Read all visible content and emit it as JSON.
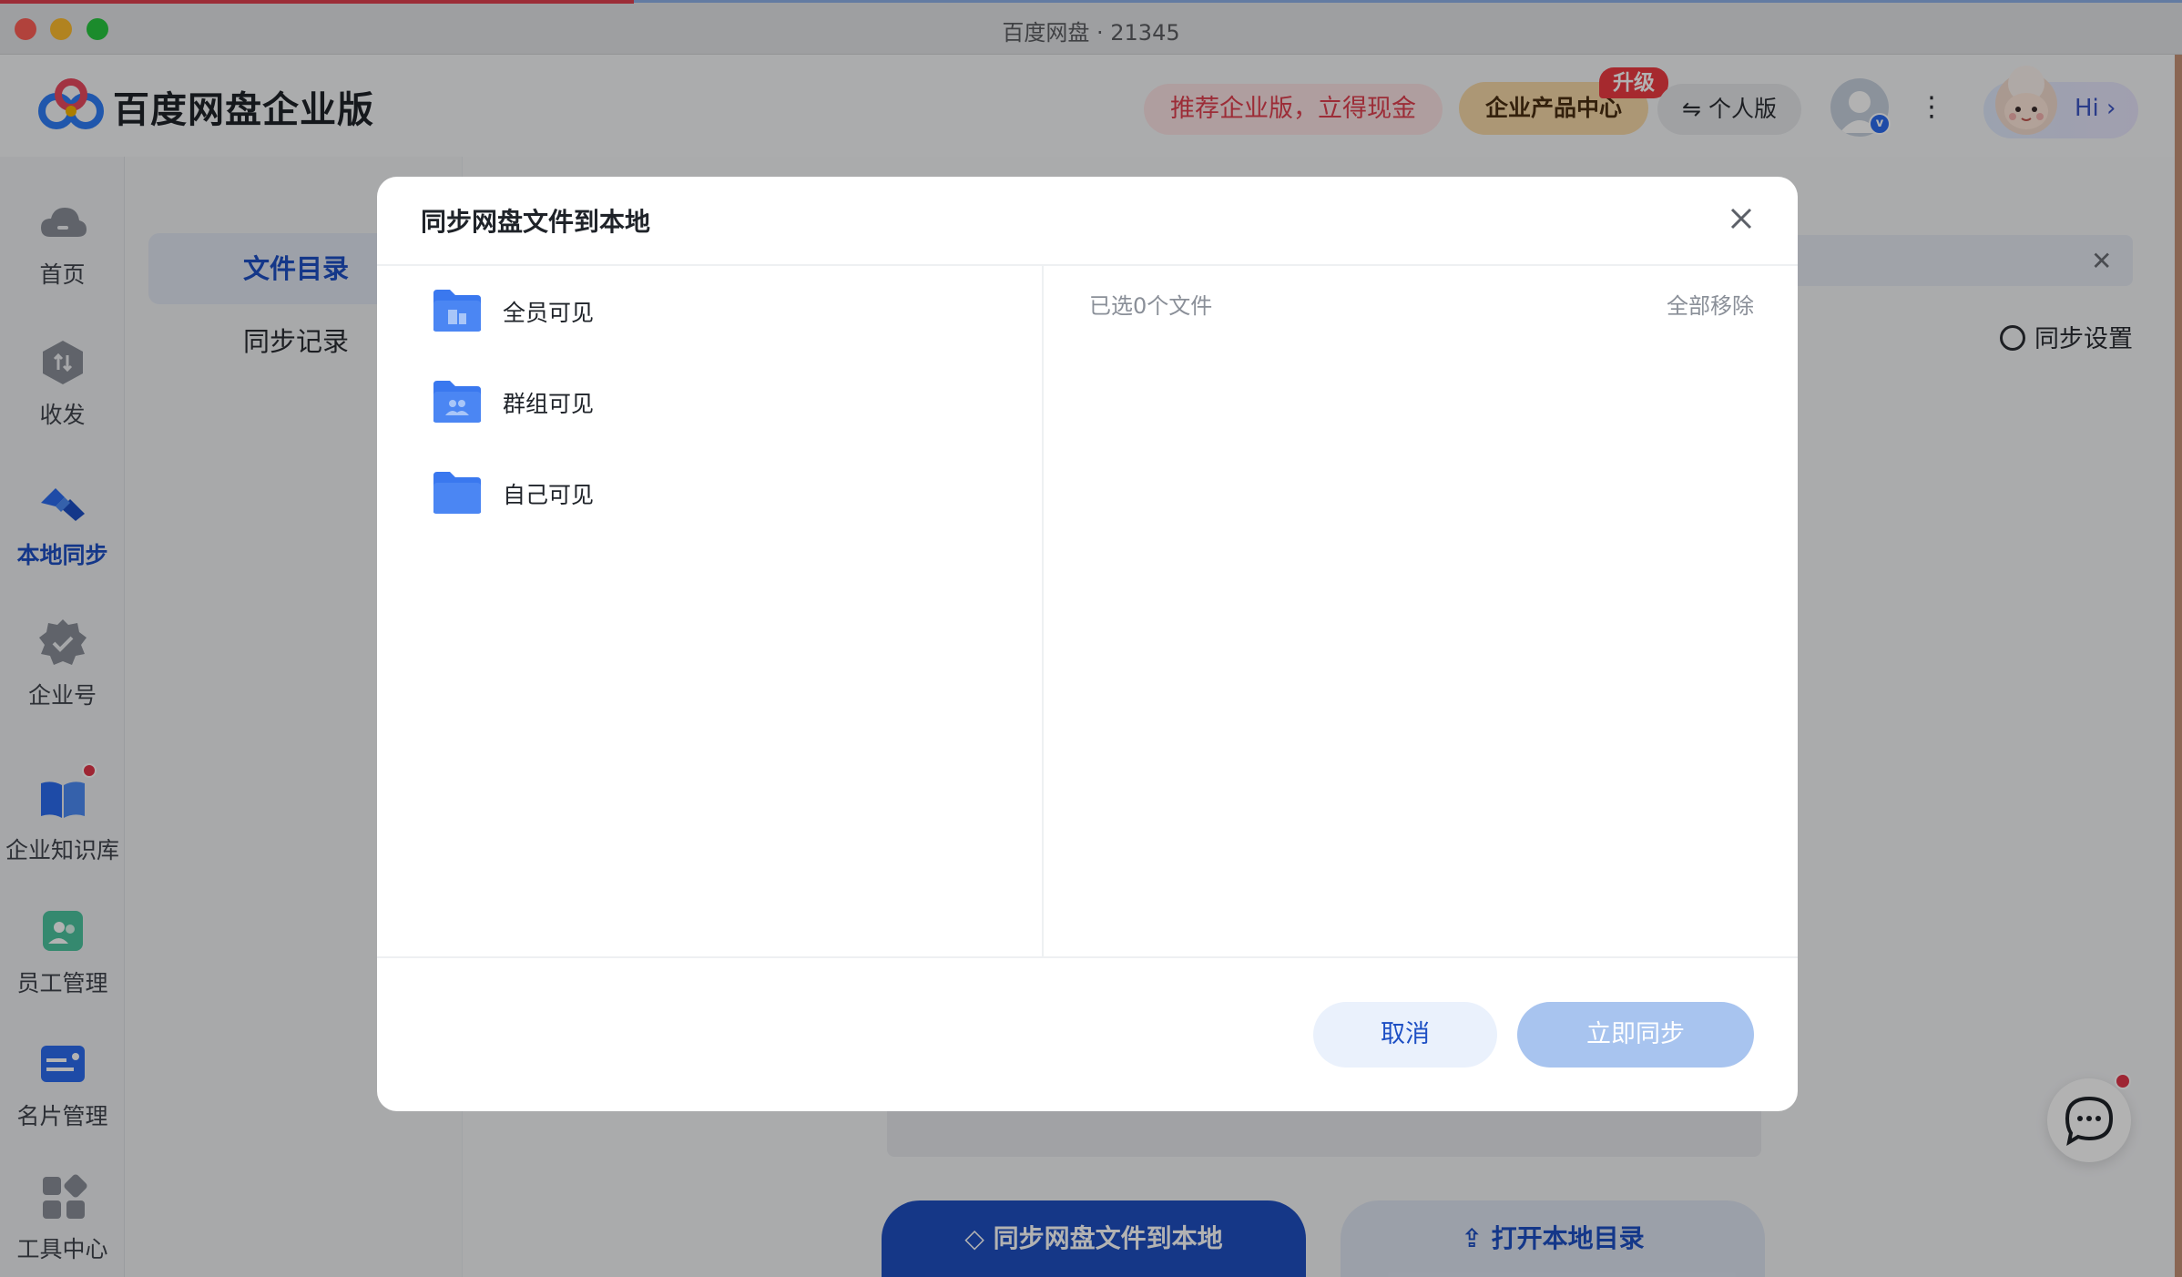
{
  "window": {
    "title": "百度网盘 · 21345"
  },
  "header": {
    "brand": "百度网盘企业版",
    "promo": "推荐企业版，立得现金",
    "product_center": "企业产品中心",
    "upgrade_badge": "升级",
    "personal": "个人版",
    "hi": "Hi ›"
  },
  "sidebar": {
    "items": [
      {
        "label": "首页",
        "icon": "cloud-icon"
      },
      {
        "label": "收发",
        "icon": "transfer-icon"
      },
      {
        "label": "本地同步",
        "icon": "sync-icon",
        "active": true
      },
      {
        "label": "企业号",
        "icon": "verified-badge-icon"
      },
      {
        "label": "企业知识库",
        "icon": "book-icon",
        "has_notification": true
      },
      {
        "label": "员工管理",
        "icon": "staff-icon"
      },
      {
        "label": "名片管理",
        "icon": "card-icon"
      },
      {
        "label": "工具中心",
        "icon": "tools-icon"
      }
    ]
  },
  "subnav": {
    "items": [
      {
        "label": "文件目录",
        "active": true
      },
      {
        "label": "同步记录"
      }
    ]
  },
  "content": {
    "sync_settings": "同步设置",
    "sync_button": "同步网盘文件到本地",
    "open_button": "打开本地目录"
  },
  "modal": {
    "title": "同步网盘文件到本地",
    "folders": [
      {
        "label": "全员可见",
        "icon": "building-folder-icon"
      },
      {
        "label": "群组可见",
        "icon": "group-folder-icon"
      },
      {
        "label": "自己可见",
        "icon": "folder-icon"
      }
    ],
    "selected_count": "已选0个文件",
    "remove_all": "全部移除",
    "cancel": "取消",
    "confirm": "立即同步"
  },
  "colors": {
    "accent": "#1d4fc4",
    "promo_text": "#e0404f",
    "disabled_button": "#a8c4ef",
    "badge_red": "#ee3b42"
  }
}
